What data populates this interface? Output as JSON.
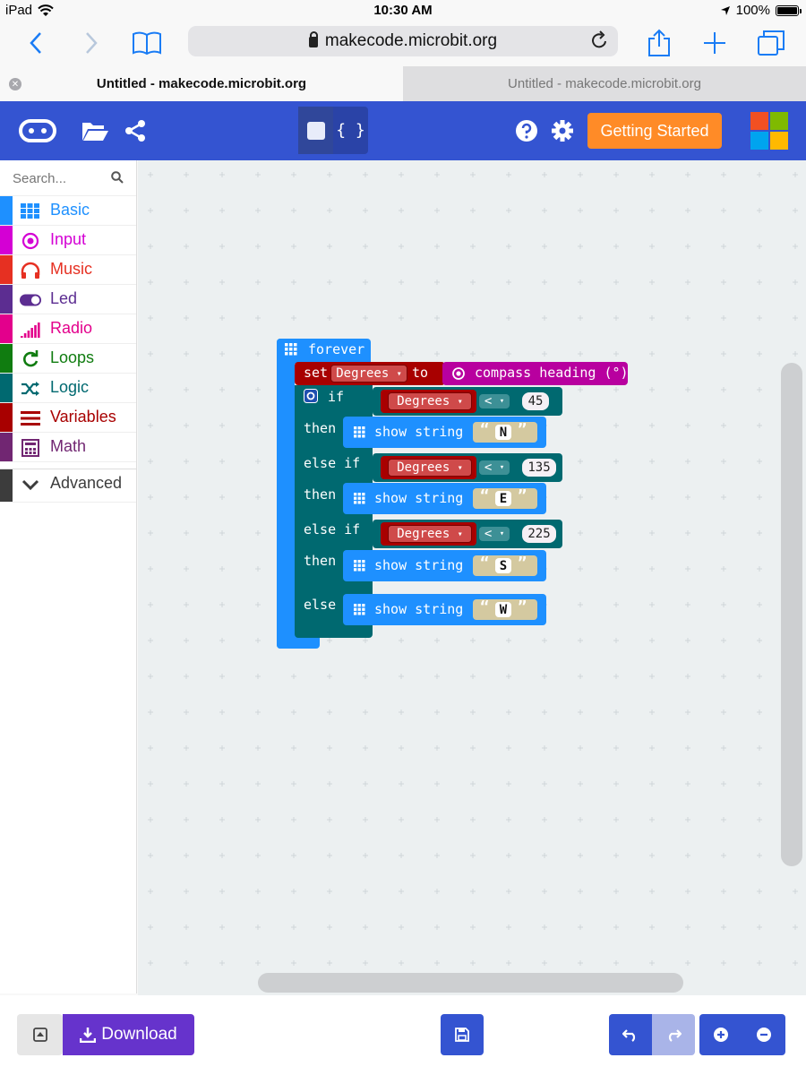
{
  "status_bar": {
    "device": "iPad",
    "time": "10:30 AM",
    "battery": "100%"
  },
  "browser": {
    "url": "makecode.microbit.org",
    "tabs": [
      {
        "title": "Untitled - makecode.microbit.org",
        "active": true
      },
      {
        "title": "Untitled - makecode.microbit.org",
        "active": false
      }
    ]
  },
  "header": {
    "getting_started": "Getting Started",
    "editor_modes": [
      "blocks",
      "javascript"
    ],
    "js_glyph": "{ }"
  },
  "toolbox": {
    "search_placeholder": "Search...",
    "categories": [
      {
        "label": "Basic",
        "color": "#1e90ff",
        "icon": "grid-icon"
      },
      {
        "label": "Input",
        "color": "#d400d4",
        "icon": "target-icon"
      },
      {
        "label": "Music",
        "color": "#e63022",
        "icon": "headphones-icon"
      },
      {
        "label": "Led",
        "color": "#5c2d91",
        "icon": "toggle-icon"
      },
      {
        "label": "Radio",
        "color": "#e3008c",
        "icon": "signal-icon"
      },
      {
        "label": "Loops",
        "color": "#107c10",
        "icon": "loop-icon"
      },
      {
        "label": "Logic",
        "color": "#006970",
        "icon": "shuffle-icon"
      },
      {
        "label": "Variables",
        "color": "#a80000",
        "icon": "lines-icon"
      },
      {
        "label": "Math",
        "color": "#712672",
        "icon": "calculator-icon"
      }
    ],
    "advanced": {
      "label": "Advanced",
      "color": "#3c3c3c"
    }
  },
  "blocks": {
    "forever": "forever",
    "set": "set",
    "to": "to",
    "variable": "Degrees",
    "compass": "compass heading (°)",
    "if": "if",
    "then": "then",
    "else_if": "else if",
    "else": "else",
    "show_string": "show string",
    "op": "<",
    "thresholds": [
      "45",
      "135",
      "225"
    ],
    "letters": [
      "N",
      "E",
      "S",
      "W"
    ],
    "dropdown_arrow": "▾",
    "quote_open": "“",
    "quote_close": "”"
  },
  "footer": {
    "download": "Download"
  },
  "colors": {
    "header": "#3454d1",
    "basic": "#1e90ff",
    "logic": "#006970",
    "variables": "#a80000",
    "input": "#d400d4",
    "getting_started": "#ff8b27",
    "download": "#6633cc"
  }
}
